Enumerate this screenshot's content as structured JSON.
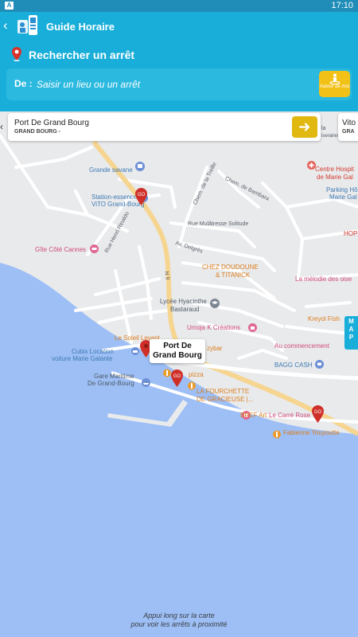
{
  "status_bar": {
    "time": "17:10"
  },
  "app_bar": {
    "back_glyph": "‹",
    "title": "Guide Horaire"
  },
  "search": {
    "heading": "Rechercher un arrêt",
    "from_label": "De :",
    "placeholder": "Saisir un lieu ou un arrêt",
    "around_me_label": "Autour de moi"
  },
  "stop_card": {
    "prev_glyph": "‹",
    "name": "Port De Grand Bourg",
    "town": "GRAND BOURG -",
    "go_icon": "arrow-right-icon",
    "next_name": "Vito",
    "next_town": "GRA"
  },
  "map_tab": {
    "letters": [
      "M",
      "A",
      "P"
    ]
  },
  "callout": {
    "line1": "Port De",
    "line2": "Grand Bourg"
  },
  "map_labels": {
    "grande_savane": "Grande savane",
    "station_1": "Station-essence",
    "station_2": "ViTO Grand-Bourg",
    "gite": "Gîte Côté Cannes",
    "rue_rinaldo": "Rue Henri Rinaldo",
    "n9": "N 9",
    "rue_mulatresse": "Rue Mulâtresse Solitude",
    "av_delgres": "Av. Delgrès",
    "chem_treille": "Chem. de la Treille",
    "chem_bambara": "Chem. de Bambara",
    "centre_hosp_1": "Centre Hospit",
    "centre_hosp_2": "de Marie Gal",
    "parking_1": "Parking Hô",
    "parking_2": "Marie Gal",
    "hop": "HOP",
    "chez_1": "CHEZ DOUDOUNE",
    "chez_2": "& TITANICK",
    "melodie": "La mélodie des oise",
    "lycee_1": "Lycée Hyacinthe",
    "lycee_2": "Bastaraud",
    "kreyol": "Kreyol Fish",
    "umoja": "Umoja K Créations",
    "soleil": "Le Soleil Levant",
    "zybar": "zybar",
    "au_commencement": "Au commencement",
    "cubix_1": "Cubix Location",
    "cubix_2": "voiture Marie Galante",
    "gare_1": "Gare Maritime",
    "gare_2": "De Grand-Bourg",
    "pizza": "pizza",
    "bagg": "BAGG CASH",
    "fourchette_1": "LA FOURCHETTE",
    "fourchette_2": "DE GRACIEUSE |...",
    "bref": "BREF Art",
    "carre": "Le Carré Rose",
    "fabienne": "Fabienne Youyoutte",
    "iseraires": "iseraires",
    "la": "la"
  },
  "hint": {
    "line1": "Appui long sur la carte",
    "line2": "pour voir les arrêts à proximité"
  },
  "colors": {
    "app_blue": "#19aed9",
    "status_blue": "#1f8db8",
    "accent_yellow": "#f2c118",
    "sea_blue": "#9dbff5",
    "land_gray": "#e9eaec",
    "main_road": "#f6d590",
    "pin_red": "#cf2f28"
  }
}
